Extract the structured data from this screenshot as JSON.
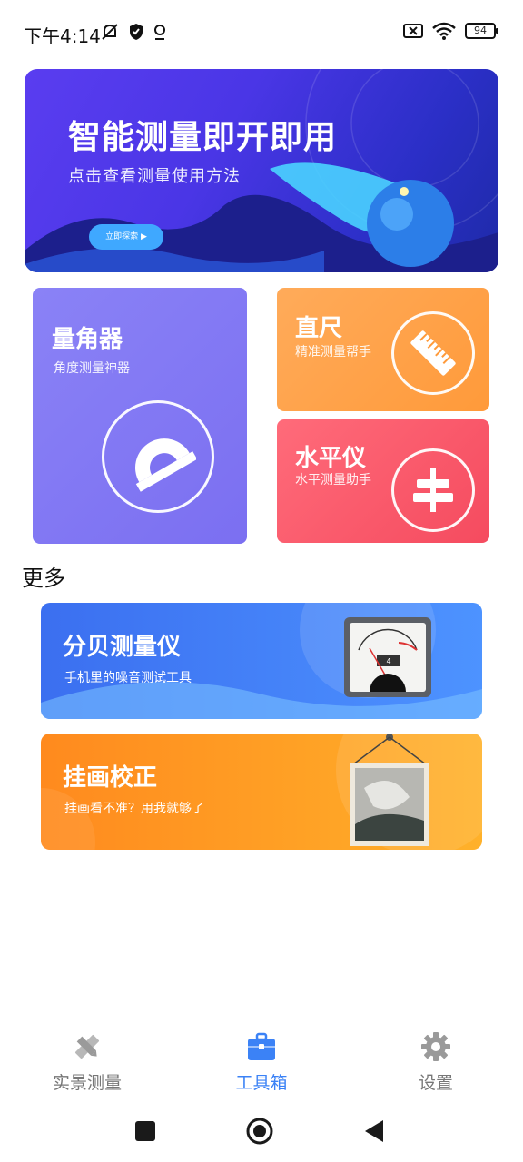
{
  "status_bar": {
    "time": "下午4:14",
    "battery": "94",
    "icons_left": [
      "mute-notification-icon",
      "shield-icon",
      "location-icon"
    ],
    "icons_right": [
      "sim-off-icon",
      "wifi-icon",
      "battery-icon"
    ]
  },
  "banner": {
    "title": "智能测量即开即用",
    "subtitle": "点击查看测量使用方法",
    "button": "立即探索 ▶"
  },
  "tools": [
    {
      "title": "量角器",
      "subtitle": "角度测量神器",
      "icon": "protractor-icon"
    },
    {
      "title": "直尺",
      "subtitle": "精准测量帮手",
      "icon": "ruler-icon"
    },
    {
      "title": "水平仪",
      "subtitle": "水平测量助手",
      "icon": "level-icon"
    }
  ],
  "more": {
    "title": "更多",
    "items": [
      {
        "title": "分贝测量仪",
        "subtitle": "手机里的噪音测试工具",
        "icon": "decibel-meter-icon",
        "meter_value": "4"
      },
      {
        "title": "挂画校正",
        "subtitle": "挂画看不准？用我就够了",
        "icon": "picture-frame-icon"
      }
    ]
  },
  "bottom_nav": {
    "items": [
      {
        "label": "实景测量",
        "icon": "pencil-ruler-icon",
        "active": false
      },
      {
        "label": "工具箱",
        "icon": "toolbox-icon",
        "active": true
      },
      {
        "label": "设置",
        "icon": "gear-icon",
        "active": false
      }
    ]
  },
  "colors": {
    "accent": "#3b82f6",
    "protractor_card": "#7b6ff1",
    "ruler_card": "#ff9a3a",
    "level_card": "#f54b5f",
    "decibel_card": "#3b6ff0",
    "frame_card": "#ff8a1e"
  }
}
